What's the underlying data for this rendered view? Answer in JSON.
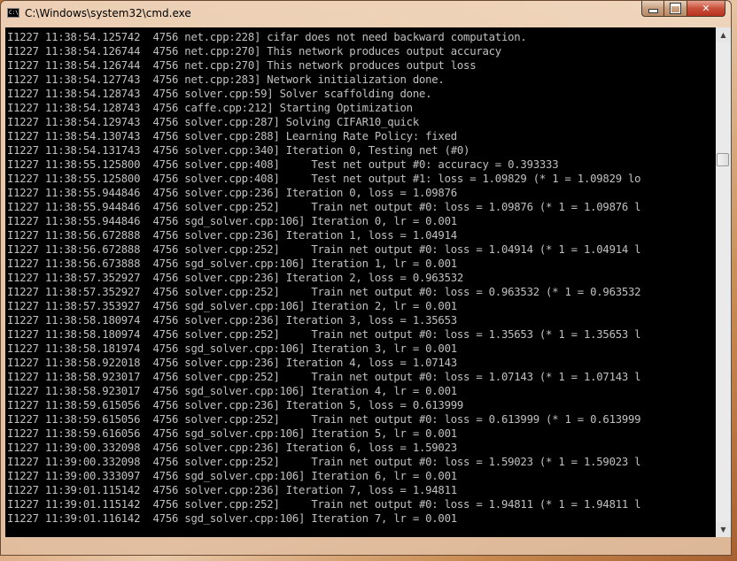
{
  "window": {
    "title": "C:\\Windows\\system32\\cmd.exe",
    "icon": "cmd-icon"
  },
  "controls": {
    "minimize": "minimize-icon",
    "maximize": "maximize-icon",
    "close": "close-icon",
    "close_glyph": "✕"
  },
  "scrollbar": {
    "up_glyph": "▲",
    "down_glyph": "▼"
  },
  "console": {
    "lines": [
      "I1227 11:38:54.125742  4756 net.cpp:228] cifar does not need backward computation.",
      "I1227 11:38:54.126744  4756 net.cpp:270] This network produces output accuracy",
      "I1227 11:38:54.126744  4756 net.cpp:270] This network produces output loss",
      "I1227 11:38:54.127743  4756 net.cpp:283] Network initialization done.",
      "I1227 11:38:54.128743  4756 solver.cpp:59] Solver scaffolding done.",
      "I1227 11:38:54.128743  4756 caffe.cpp:212] Starting Optimization",
      "I1227 11:38:54.129743  4756 solver.cpp:287] Solving CIFAR10_quick",
      "I1227 11:38:54.130743  4756 solver.cpp:288] Learning Rate Policy: fixed",
      "I1227 11:38:54.131743  4756 solver.cpp:340] Iteration 0, Testing net (#0)",
      "I1227 11:38:55.125800  4756 solver.cpp:408]     Test net output #0: accuracy = 0.393333",
      "I1227 11:38:55.125800  4756 solver.cpp:408]     Test net output #1: loss = 1.09829 (* 1 = 1.09829 lo",
      "I1227 11:38:55.944846  4756 solver.cpp:236] Iteration 0, loss = 1.09876",
      "I1227 11:38:55.944846  4756 solver.cpp:252]     Train net output #0: loss = 1.09876 (* 1 = 1.09876 l",
      "I1227 11:38:55.944846  4756 sgd_solver.cpp:106] Iteration 0, lr = 0.001",
      "I1227 11:38:56.672888  4756 solver.cpp:236] Iteration 1, loss = 1.04914",
      "I1227 11:38:56.672888  4756 solver.cpp:252]     Train net output #0: loss = 1.04914 (* 1 = 1.04914 l",
      "I1227 11:38:56.673888  4756 sgd_solver.cpp:106] Iteration 1, lr = 0.001",
      "I1227 11:38:57.352927  4756 solver.cpp:236] Iteration 2, loss = 0.963532",
      "I1227 11:38:57.352927  4756 solver.cpp:252]     Train net output #0: loss = 0.963532 (* 1 = 0.963532",
      "I1227 11:38:57.353927  4756 sgd_solver.cpp:106] Iteration 2, lr = 0.001",
      "I1227 11:38:58.180974  4756 solver.cpp:236] Iteration 3, loss = 1.35653",
      "I1227 11:38:58.180974  4756 solver.cpp:252]     Train net output #0: loss = 1.35653 (* 1 = 1.35653 l",
      "I1227 11:38:58.181974  4756 sgd_solver.cpp:106] Iteration 3, lr = 0.001",
      "I1227 11:38:58.922018  4756 solver.cpp:236] Iteration 4, loss = 1.07143",
      "I1227 11:38:58.923017  4756 solver.cpp:252]     Train net output #0: loss = 1.07143 (* 1 = 1.07143 l",
      "I1227 11:38:58.923017  4756 sgd_solver.cpp:106] Iteration 4, lr = 0.001",
      "I1227 11:38:59.615056  4756 solver.cpp:236] Iteration 5, loss = 0.613999",
      "I1227 11:38:59.615056  4756 solver.cpp:252]     Train net output #0: loss = 0.613999 (* 1 = 0.613999",
      "I1227 11:38:59.616056  4756 sgd_solver.cpp:106] Iteration 5, lr = 0.001",
      "I1227 11:39:00.332098  4756 solver.cpp:236] Iteration 6, loss = 1.59023",
      "I1227 11:39:00.332098  4756 solver.cpp:252]     Train net output #0: loss = 1.59023 (* 1 = 1.59023 l",
      "I1227 11:39:00.333097  4756 sgd_solver.cpp:106] Iteration 6, lr = 0.001",
      "I1227 11:39:01.115142  4756 solver.cpp:236] Iteration 7, loss = 1.94811",
      "I1227 11:39:01.115142  4756 solver.cpp:252]     Train net output #0: loss = 1.94811 (* 1 = 1.94811 l",
      "I1227 11:39:01.116142  4756 sgd_solver.cpp:106] Iteration 7, lr = 0.001"
    ]
  },
  "colors": {
    "console_bg": "#000000",
    "console_text": "#c0c0c0",
    "close_button": "#c8503a"
  }
}
